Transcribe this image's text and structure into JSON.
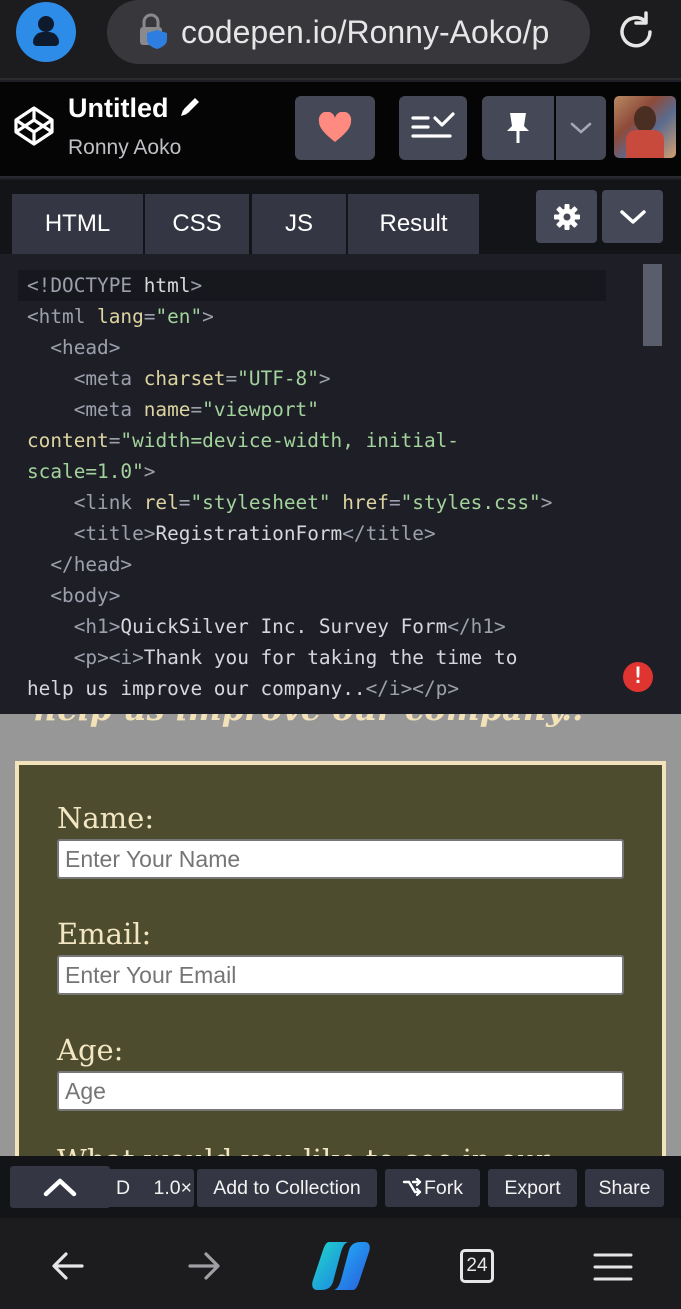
{
  "browser": {
    "url": "codepen.io/Ronny-Aoko/p",
    "tab_count": "24"
  },
  "pen": {
    "title": "Untitled",
    "author": "Ronny Aoko"
  },
  "tabs": [
    {
      "label": "HTML"
    },
    {
      "label": "CSS"
    },
    {
      "label": "JS"
    },
    {
      "label": "Result"
    }
  ],
  "code_lines": [
    "<!DOCTYPE html>",
    "<html lang=\"en\">",
    "  <head>",
    "    <meta charset=\"UTF-8\">",
    "    <meta name=\"viewport\"",
    "content=\"width=device-width, initial-",
    "scale=1.0\">",
    "    <link rel=\"stylesheet\" href=\"styles.css\">",
    "    <title>RegistrationForm</title>",
    "  </head>",
    "  <body>",
    "    <h1>QuickSilver Inc. Survey Form</h1>",
    "    <p><i>Thank you for taking the time to",
    "help us improve our company..</i></p>"
  ],
  "error_badge": "!",
  "preview": {
    "cut_text": "help us improve our company..",
    "fields": [
      {
        "label": "Name:",
        "placeholder": "Enter Your Name"
      },
      {
        "label": "Email:",
        "placeholder": "Enter Your Email"
      },
      {
        "label": "Age:",
        "placeholder": "Age"
      }
    ],
    "partial_label": "What would you like to see in our"
  },
  "footer": {
    "d_label": "D",
    "zoom": "1.0×",
    "collection": "Add to Collection",
    "fork": "Fork",
    "export": "Export",
    "share": "Share"
  },
  "colors": {
    "accent_heart": "#ff8a80",
    "form_bg": "#4e4c2e",
    "form_text": "#f3e6c2",
    "error": "#e03430"
  }
}
